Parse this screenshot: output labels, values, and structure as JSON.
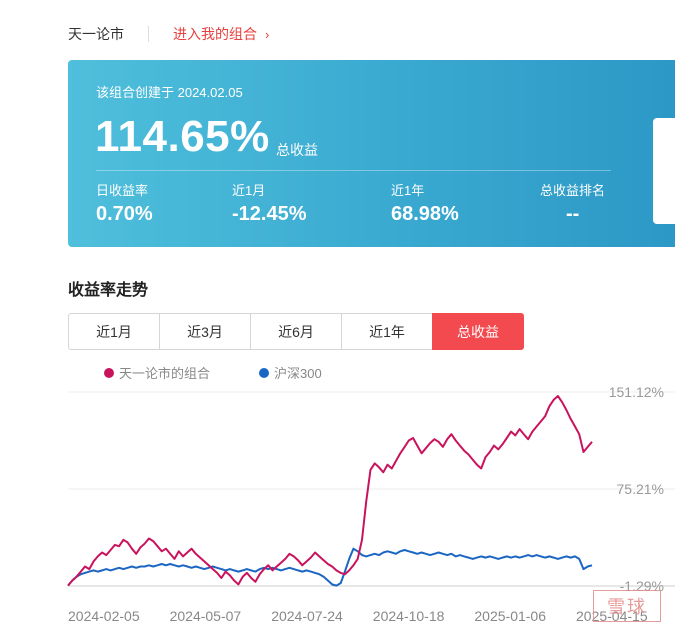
{
  "header": {
    "user": "天一论市",
    "link_label": "进入我的组合",
    "chevron_icon": "chevron-right-icon"
  },
  "summary": {
    "created": "该组合创建于 2024.02.05",
    "total_return": "114.65%",
    "total_return_label": "总收益",
    "stats": [
      {
        "label": "日收益率",
        "value": "0.70%"
      },
      {
        "label": "近1月",
        "value": "-12.45%"
      },
      {
        "label": "近1年",
        "value": "68.98%"
      },
      {
        "label": "总收益排名",
        "value": "--"
      }
    ]
  },
  "trend": {
    "title": "收益率走势",
    "tabs": [
      "近1月",
      "近3月",
      "近6月",
      "近1年",
      "总收益"
    ],
    "active_tab": 4
  },
  "watermark": "雪球",
  "colors": {
    "portfolio": "#c9135c",
    "index": "#1a66c2",
    "accent": "#f24a4f",
    "card_start": "#4fbfdc",
    "card_end": "#2c98c6"
  },
  "chart_data": {
    "type": "line",
    "title": "",
    "xlabel": "",
    "ylabel": "",
    "x_tick_labels": [
      "2024-02-05",
      "2024-05-07",
      "2024-07-24",
      "2024-10-18",
      "2025-01-06",
      "2025-04-15"
    ],
    "y_tick_labels": [
      "151.12%",
      "75.21%",
      "-1.29%"
    ],
    "ylim": [
      -1.29,
      151.12
    ],
    "grid": true,
    "legend_position": "top-left",
    "series": [
      {
        "name": "天一论市的组合",
        "color": "#c9135c",
        "values": [
          -1,
          3,
          6,
          10,
          14,
          12,
          18,
          22,
          25,
          23,
          27,
          31,
          30,
          35,
          33,
          28,
          24,
          29,
          32,
          36,
          34,
          30,
          26,
          28,
          24,
          20,
          26,
          22,
          25,
          28,
          24,
          21,
          18,
          15,
          12,
          9,
          5,
          10,
          7,
          3,
          0,
          6,
          9,
          5,
          2,
          8,
          12,
          15,
          11,
          14,
          17,
          20,
          24,
          22,
          19,
          15,
          18,
          21,
          25,
          22,
          19,
          16,
          14,
          11,
          9,
          8,
          11,
          15,
          20,
          35,
          65,
          90,
          95,
          92,
          88,
          94,
          91,
          97,
          103,
          108,
          113,
          115,
          109,
          103,
          107,
          111,
          114,
          112,
          108,
          114,
          118,
          113,
          109,
          105,
          102,
          98,
          94,
          91,
          100,
          104,
          109,
          106,
          110,
          115,
          120,
          117,
          122,
          118,
          114,
          120,
          124,
          128,
          132,
          140,
          145,
          148,
          143,
          137,
          130,
          124,
          118,
          104,
          108,
          112
        ]
      },
      {
        "name": "沪深300",
        "color": "#1a66c2",
        "values": [
          -1,
          3,
          6,
          8,
          9,
          10,
          11,
          10,
          11,
          12,
          11,
          12,
          13,
          12,
          13,
          14,
          13,
          14,
          14,
          15,
          14,
          15,
          16,
          15,
          16,
          15,
          14,
          15,
          14,
          13,
          14,
          13,
          12,
          13,
          14,
          13,
          12,
          11,
          12,
          11,
          10,
          11,
          12,
          11,
          10,
          12,
          13,
          12,
          13,
          12,
          11,
          12,
          13,
          12,
          11,
          10,
          11,
          10,
          9,
          8,
          6,
          3,
          0,
          -1,
          1,
          10,
          20,
          28,
          26,
          23,
          22,
          23,
          24,
          23,
          25,
          26,
          25,
          24,
          26,
          27,
          26,
          25,
          24,
          25,
          24,
          23,
          24,
          25,
          24,
          23,
          24,
          22,
          23,
          22,
          21,
          20,
          21,
          22,
          21,
          22,
          21,
          20,
          21,
          22,
          21,
          22,
          21,
          22,
          23,
          22,
          23,
          22,
          21,
          22,
          21,
          20,
          21,
          22,
          21,
          22,
          20,
          12,
          14,
          15
        ]
      }
    ]
  }
}
